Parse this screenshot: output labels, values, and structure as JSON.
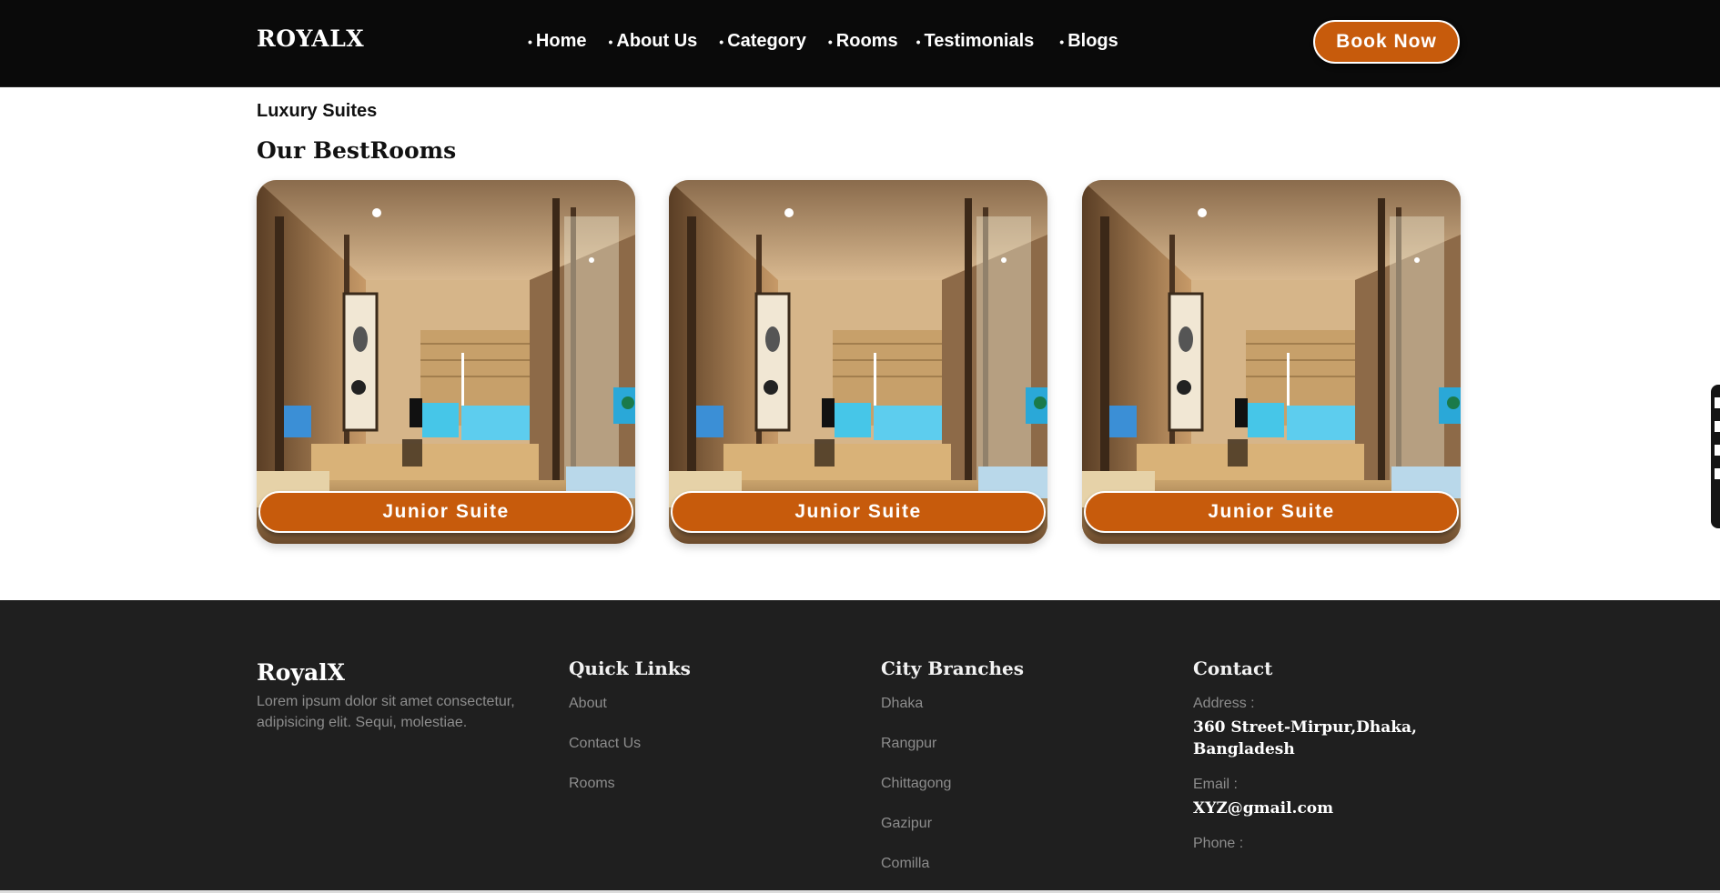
{
  "navbar": {
    "brand": "ROYALX",
    "items": [
      "Home",
      "About Us",
      "Category",
      "Rooms",
      "Testimonials",
      "Blogs"
    ],
    "book_button": "Book Now"
  },
  "main": {
    "kicker": "Luxury Suites",
    "title": "Our BestRooms",
    "rooms": [
      {
        "label": "Junior Suite"
      },
      {
        "label": "Junior Suite"
      },
      {
        "label": "Junior Suite"
      }
    ]
  },
  "footer": {
    "brand": "RoyalX",
    "description": "Lorem ipsum dolor sit amet consectetur, adipisicing elit. Sequi, molestiae.",
    "quick_links": {
      "title": "Quick Links",
      "items": [
        "About",
        "Contact Us",
        "Rooms"
      ]
    },
    "branches": {
      "title": "City Branches",
      "items": [
        "Dhaka",
        "Rangpur",
        "Chittagong",
        "Gazipur",
        "Comilla"
      ]
    },
    "contact": {
      "title": "Contact",
      "address_label": "Address :",
      "address": "360 Street-Mirpur,Dhaka, Bangladesh",
      "email_label": "Email :",
      "email": "XYZ@gmail.com",
      "phone_label": "Phone :"
    }
  },
  "colors": {
    "accent": "#c75b0c",
    "nav_bg": "#0a0a0a",
    "footer_bg": "#1f1f1f"
  },
  "icons": {
    "nav_bullet": "bullet-dot"
  }
}
